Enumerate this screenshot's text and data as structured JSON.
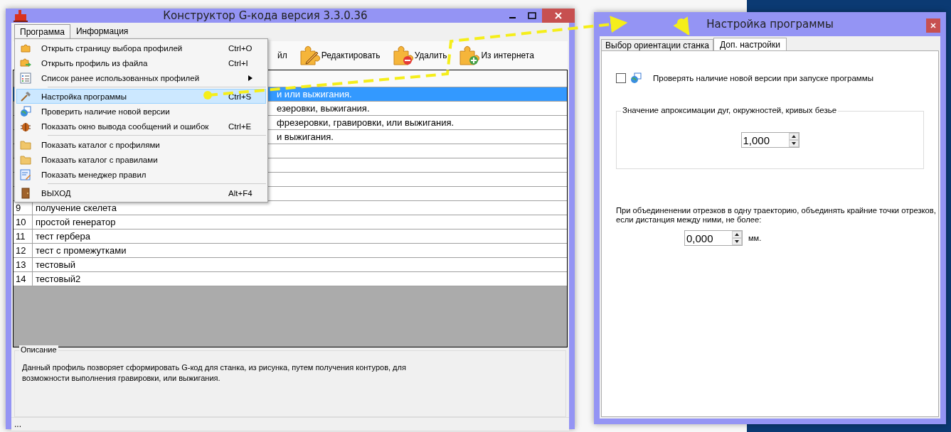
{
  "main_window": {
    "title": "Конструктор G-кода версия 3.3.0.36",
    "menubar": [
      {
        "label": "Программа",
        "selected": true
      },
      {
        "label": "Информация",
        "selected": false
      }
    ],
    "toolbar": [
      {
        "label": "йл"
      },
      {
        "label": "Редактировать"
      },
      {
        "label": "Удалить"
      },
      {
        "label": "Из интернета"
      }
    ],
    "menu": [
      {
        "kind": "item",
        "label": "Открыть страницу выбора профилей",
        "shortcut": "Ctrl+O",
        "submenu": false,
        "selected": false
      },
      {
        "kind": "item",
        "label": "Открыть профиль из файла",
        "shortcut": "Ctrl+I",
        "submenu": false,
        "selected": false
      },
      {
        "kind": "item",
        "label": "Список ранее использованных профилей",
        "submenu": true,
        "selected": false
      },
      {
        "kind": "separator"
      },
      {
        "kind": "item",
        "label": "Настройка программы",
        "shortcut": "Ctrl+S",
        "submenu": false,
        "selected": true
      },
      {
        "kind": "item",
        "label": "Проверить наличие новой версии",
        "submenu": false,
        "selected": false
      },
      {
        "kind": "item",
        "label": "Показать окно вывода сообщений и ошибок",
        "shortcut": "Ctrl+E",
        "submenu": false,
        "selected": false
      },
      {
        "kind": "separator"
      },
      {
        "kind": "item",
        "label": "Показать каталог с профилями",
        "submenu": false,
        "selected": false
      },
      {
        "kind": "item",
        "label": "Показать каталог с правилами",
        "submenu": false,
        "selected": false
      },
      {
        "kind": "item",
        "label": "Показать менеджер правил",
        "submenu": false,
        "selected": false
      },
      {
        "kind": "separator"
      },
      {
        "kind": "item",
        "label": "ВЫХОД",
        "shortcut": "Alt+F4",
        "submenu": false,
        "selected": false
      }
    ],
    "table": {
      "rows": [
        {
          "kind": "covered",
          "text": "и или выжигания.",
          "selected": true
        },
        {
          "kind": "covered",
          "text": "езеровки, выжигания.",
          "selected": false
        },
        {
          "kind": "covered",
          "text": "фрезеровки, гравировки, или выжигания.",
          "selected": false
        },
        {
          "kind": "covered",
          "text": "и выжигания.",
          "selected": false
        },
        {
          "kind": "covered",
          "selected": false
        },
        {
          "kind": "covered",
          "selected": false
        },
        {
          "kind": "covered",
          "selected": false
        },
        {
          "kind": "covered",
          "selected": false
        },
        {
          "kind": "full",
          "number": "9",
          "text": "получение скелета",
          "selected": false
        },
        {
          "kind": "full",
          "number": "10",
          "text": "простой генератор",
          "selected": false
        },
        {
          "kind": "full",
          "number": "11",
          "text": "тест гербера",
          "selected": false
        },
        {
          "kind": "full",
          "number": "12",
          "text": "тест с промежутками",
          "selected": false
        },
        {
          "kind": "full",
          "number": "13",
          "text": "тестовый",
          "selected": false
        },
        {
          "kind": "full",
          "number": "14",
          "text": "тестовый2",
          "selected": false
        }
      ]
    },
    "description": {
      "title": "Описание",
      "text": "Данный профиль позворяет сформировать G-код для станка, из рисунка, путем получения контуров, для возможности выполнения гравировки, или выжигания."
    },
    "status_bar": "..."
  },
  "settings_dialog": {
    "title": "Настройка программы",
    "tabs": [
      {
        "label": "Выбор ориентации станка",
        "selected": false
      },
      {
        "label": "Доп. настройки",
        "selected": true
      }
    ],
    "check_updates": {
      "label": "Проверять наличие новой версии при запуске программы",
      "checked": false
    },
    "approximation": {
      "title": "Значение апроксимации дуг, окружностей, кривых безье",
      "value": "1,000"
    },
    "merge": {
      "text": "При объединенении отрезков в одну траекторию, объединять крайние точки отрезков, если дистанция между ними, не более:",
      "value": "0,000",
      "unit": "мм."
    }
  }
}
